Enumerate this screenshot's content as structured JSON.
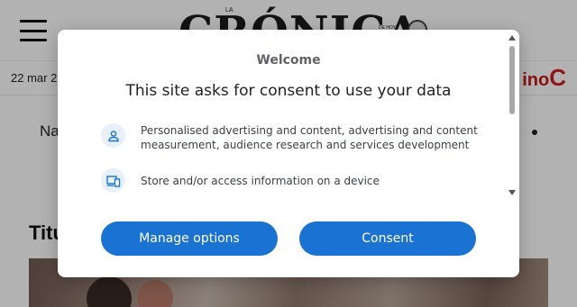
{
  "site": {
    "menu_label": "",
    "logo_text": "CRÓNICA",
    "logo_small_top": "LA",
    "logo_small_right": "DE HOY",
    "date_text": "22 mar 2",
    "brand_right_text": "ino",
    "brand_right_letter": "C",
    "nav_text": "Na",
    "headline_text": "Titu"
  },
  "consent": {
    "welcome": "Welcome",
    "title": "This site asks for consent to use your data",
    "purposes": [
      {
        "icon": "person-icon",
        "text": "Personalised advertising and content, advertising and content measurement, audience research and services development"
      },
      {
        "icon": "devices-icon",
        "text": "Store and/or access information on a device"
      }
    ],
    "buttons": {
      "manage": "Manage options",
      "consent": "Consent"
    }
  },
  "colors": {
    "button_blue": "#1a73d3",
    "icon_bg": "#e7f0fb",
    "brand_red": "#d11e24"
  }
}
